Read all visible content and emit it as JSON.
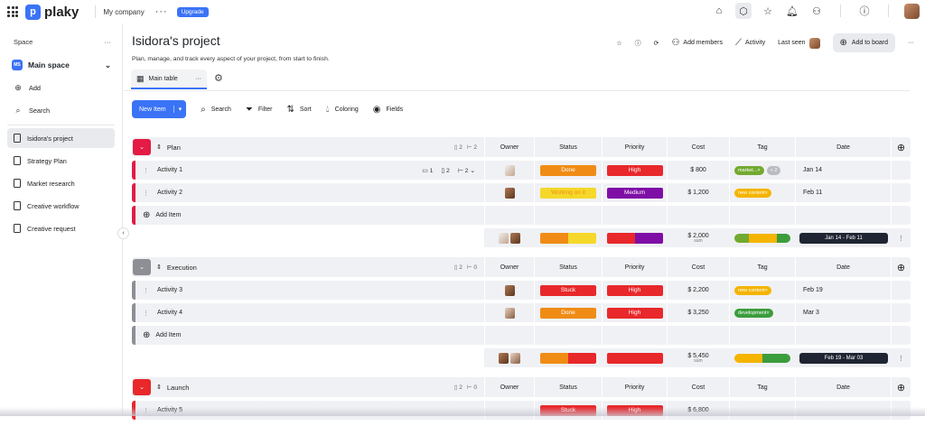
{
  "topbar": {
    "logo_text": "plaky",
    "logo_glyph": "p",
    "company": "My company",
    "more": "···",
    "upgrade": "Upgrade",
    "icons": [
      "home-icon",
      "cube-icon",
      "star-icon",
      "bell-icon",
      "person-add-icon",
      "help-icon"
    ]
  },
  "sidebar": {
    "header": "Space",
    "header_more": "···",
    "space": {
      "badge": "MS",
      "label": "Main space",
      "chevron": "⌄"
    },
    "actions": [
      {
        "icon": "plus-icon",
        "glyph": "⊕",
        "label": "Add"
      },
      {
        "icon": "search-icon",
        "glyph": "⌕",
        "label": "Search"
      }
    ],
    "projects": [
      {
        "label": "Isidora's project",
        "active": true
      },
      {
        "label": "Strategy Plan",
        "active": false
      },
      {
        "label": "Market research",
        "active": false
      },
      {
        "label": "Creative workflow",
        "active": false
      },
      {
        "label": "Creative request",
        "active": false
      }
    ],
    "collapse": "‹"
  },
  "header": {
    "title": "Isidora's project",
    "description": "Plan, manage, and track every aspect of your project, from start to finish.",
    "add_members": "Add members",
    "activity": "Activity",
    "last_seen": "Last seen",
    "add_to_board": "Add to board",
    "more": "···"
  },
  "view": {
    "tab_label": "Main table",
    "tab_more": "···"
  },
  "toolbar": {
    "new_item": "New Item",
    "new_item_caret": "▾",
    "search": "Search",
    "filter": "Filter",
    "sort": "Sort",
    "coloring": "Coloring",
    "fields": "Fields"
  },
  "columns": {
    "owner": "Owner",
    "status": "Status",
    "priority": "Priority",
    "cost": "Cost",
    "tag": "Tag",
    "date": "Date"
  },
  "add_item": "Add Item",
  "colors": {
    "done": "#f08c15",
    "stuck": "#e8282b",
    "working": "#f5d829",
    "high": "#e8282b",
    "medium": "#7e0ea6",
    "tag_market": "#73a930",
    "tag_content": "#f4b400",
    "tag_dev": "#3c9d3c",
    "plan": "#e31b45",
    "execution": "#8d8f94",
    "launch": "#e8282b",
    "dark": "#1f2533"
  },
  "groups": [
    {
      "name": "Plan",
      "color": "#e31b45",
      "files": "2",
      "subitems": "2",
      "items": [
        {
          "name": "Activity 1",
          "comments": "1",
          "files": "2",
          "subitems": "2",
          "owner": "pale",
          "status": "Done",
          "status_color": "#f08c15",
          "priority": "High",
          "priority_color": "#e8282b",
          "cost": "$ 800",
          "tags": [
            {
              "label": "market...",
              "color": "#73a930"
            },
            {
              "label": "+ 2",
              "color": "#b9bcc2"
            }
          ],
          "date": "Jan 14"
        },
        {
          "name": "Activity 2",
          "owner": "dark",
          "status": "Working on it",
          "status_color": "#f5d829",
          "priority": "Medium",
          "priority_color": "#7e0ea6",
          "cost": "$ 1,200",
          "tags": [
            {
              "label": "new content",
              "color": "#f4b400"
            }
          ],
          "date": "Feb 11"
        }
      ],
      "summary": {
        "cost": "$ 2,000",
        "cost_label": "sum",
        "date_range": "Jan 14 - Feb 11",
        "status_bar": [
          {
            "c": "#f08c15",
            "w": 50
          },
          {
            "c": "#f5d829",
            "w": 50
          }
        ],
        "prio_bar": [
          {
            "c": "#e8282b",
            "w": 50
          },
          {
            "c": "#7e0ea6",
            "w": 50
          }
        ],
        "tag_bar": [
          {
            "c": "#73a930",
            "w": 25
          },
          {
            "c": "#f4b400",
            "w": 50
          },
          {
            "c": "#3c9d3c",
            "w": 25
          }
        ],
        "owners": [
          "pale",
          "dark"
        ]
      }
    },
    {
      "name": "Execution",
      "color": "#8d8f94",
      "files": "2",
      "subitems": "0",
      "items": [
        {
          "name": "Activity 3",
          "owner": "dark",
          "status": "Stuck",
          "status_color": "#e8282b",
          "priority": "High",
          "priority_color": "#e8282b",
          "cost": "$ 2,200",
          "tags": [
            {
              "label": "new content",
              "color": "#f4b400"
            }
          ],
          "date": "Feb 19"
        },
        {
          "name": "Activity 4",
          "owner": "w",
          "status": "Done",
          "status_color": "#f08c15",
          "priority": "High",
          "priority_color": "#e8282b",
          "cost": "$ 3,250",
          "tags": [
            {
              "label": "development",
              "color": "#3c9d3c"
            }
          ],
          "date": "Mar 3"
        }
      ],
      "summary": {
        "cost": "$ 5,450",
        "cost_label": "sum",
        "date_range": "Feb 19 - Mar 03",
        "status_bar": [
          {
            "c": "#f08c15",
            "w": 50
          },
          {
            "c": "#e8282b",
            "w": 50
          }
        ],
        "prio_bar": [
          {
            "c": "#e8282b",
            "w": 100
          }
        ],
        "tag_bar": [
          {
            "c": "#f4b400",
            "w": 50
          },
          {
            "c": "#3c9d3c",
            "w": 50
          }
        ],
        "owners": [
          "dark",
          "w"
        ]
      }
    },
    {
      "name": "Launch",
      "color": "#e8282b",
      "files": "2",
      "subitems": "0",
      "items": [
        {
          "name": "Activity 5",
          "owner": "",
          "status": "Stuck",
          "status_color": "#e8282b",
          "priority": "High",
          "priority_color": "#e8282b",
          "cost": "$ 6,800",
          "tags": [],
          "date": ""
        }
      ]
    }
  ]
}
